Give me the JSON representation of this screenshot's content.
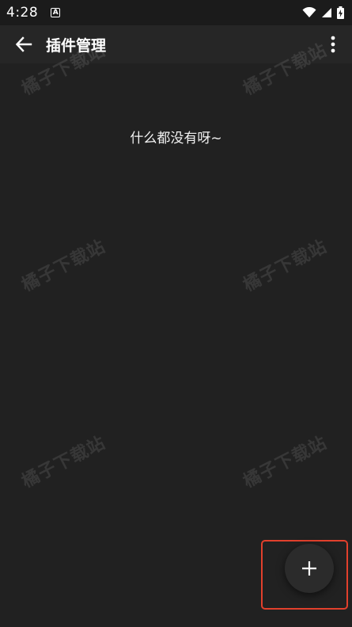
{
  "status_bar": {
    "time": "4:28",
    "notification_icon": "a-icon",
    "wifi_icon": "wifi-icon",
    "signal_icon": "signal-icon",
    "battery_icon": "battery-charging-icon"
  },
  "app_bar": {
    "back_icon": "arrow-back-icon",
    "title": "插件管理",
    "more_icon": "more-vert-icon"
  },
  "content": {
    "empty_message": "什么都没有呀~"
  },
  "watermark": {
    "text": "橘子下载站"
  },
  "fab": {
    "icon": "plus-icon",
    "highlight_color": "#e2402c"
  },
  "colors": {
    "background": "#212121",
    "app_bar": "#262626",
    "status_bar": "#1b1b1b"
  }
}
